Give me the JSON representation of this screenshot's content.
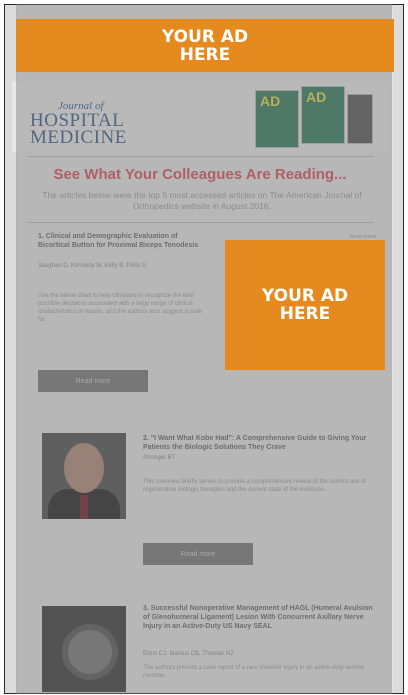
{
  "ads": {
    "top": [
      "YOUR AD",
      "HERE"
    ],
    "side": [
      "YOUR AD",
      "HERE"
    ],
    "color": "#e48a1e"
  },
  "journal": {
    "logo_small": "Journal of",
    "logo_line1": "HOSPITAL",
    "logo_line2": "MEDICINE",
    "cover_label": "AD"
  },
  "headline": "See What Your Colleagues Are Reading...",
  "intro": "The articles below were the top 5 most accessed articles on The American Journal of Orthopedics website in August 2016.",
  "articles": [
    {
      "title": "1. Clinical and Demographic Evaluation of Bicortical Button for Proximal Biceps Tenodesis",
      "meta": "Vaughan D, Kennedy M, Kelly B, Pinto S",
      "body": "Use the below chart to help clinicians to recognize the best possible decisions associated with a large range of clinical characteristics of results, and the authors also suggest to look for.",
      "button": "Read more",
      "link": "Read online"
    },
    {
      "title": "2. \"I Want What Kobe Had\": A Comprehensive Guide to Giving Your Patients the Biologic Solutions They Crave",
      "meta": "Atrooger BT",
      "body": "This overview briefly serves to provide a comprehensive review of the current use of regenerative biologic therapies and the current state of the evidence.",
      "button": "Read more"
    },
    {
      "title": "3. Successful Nonoperative Management of HAGL (Humeral Avulsion of Glenohumeral Ligament) Lesion With Concurrent Axillary Nerve Injury in an Active-Duty US Navy SEAL",
      "meta": "Ernst CJ, Marcus CB, Thomas NJ",
      "body": "The authors present a case report of a rare shoulder injury in an active-duty service member."
    }
  ]
}
